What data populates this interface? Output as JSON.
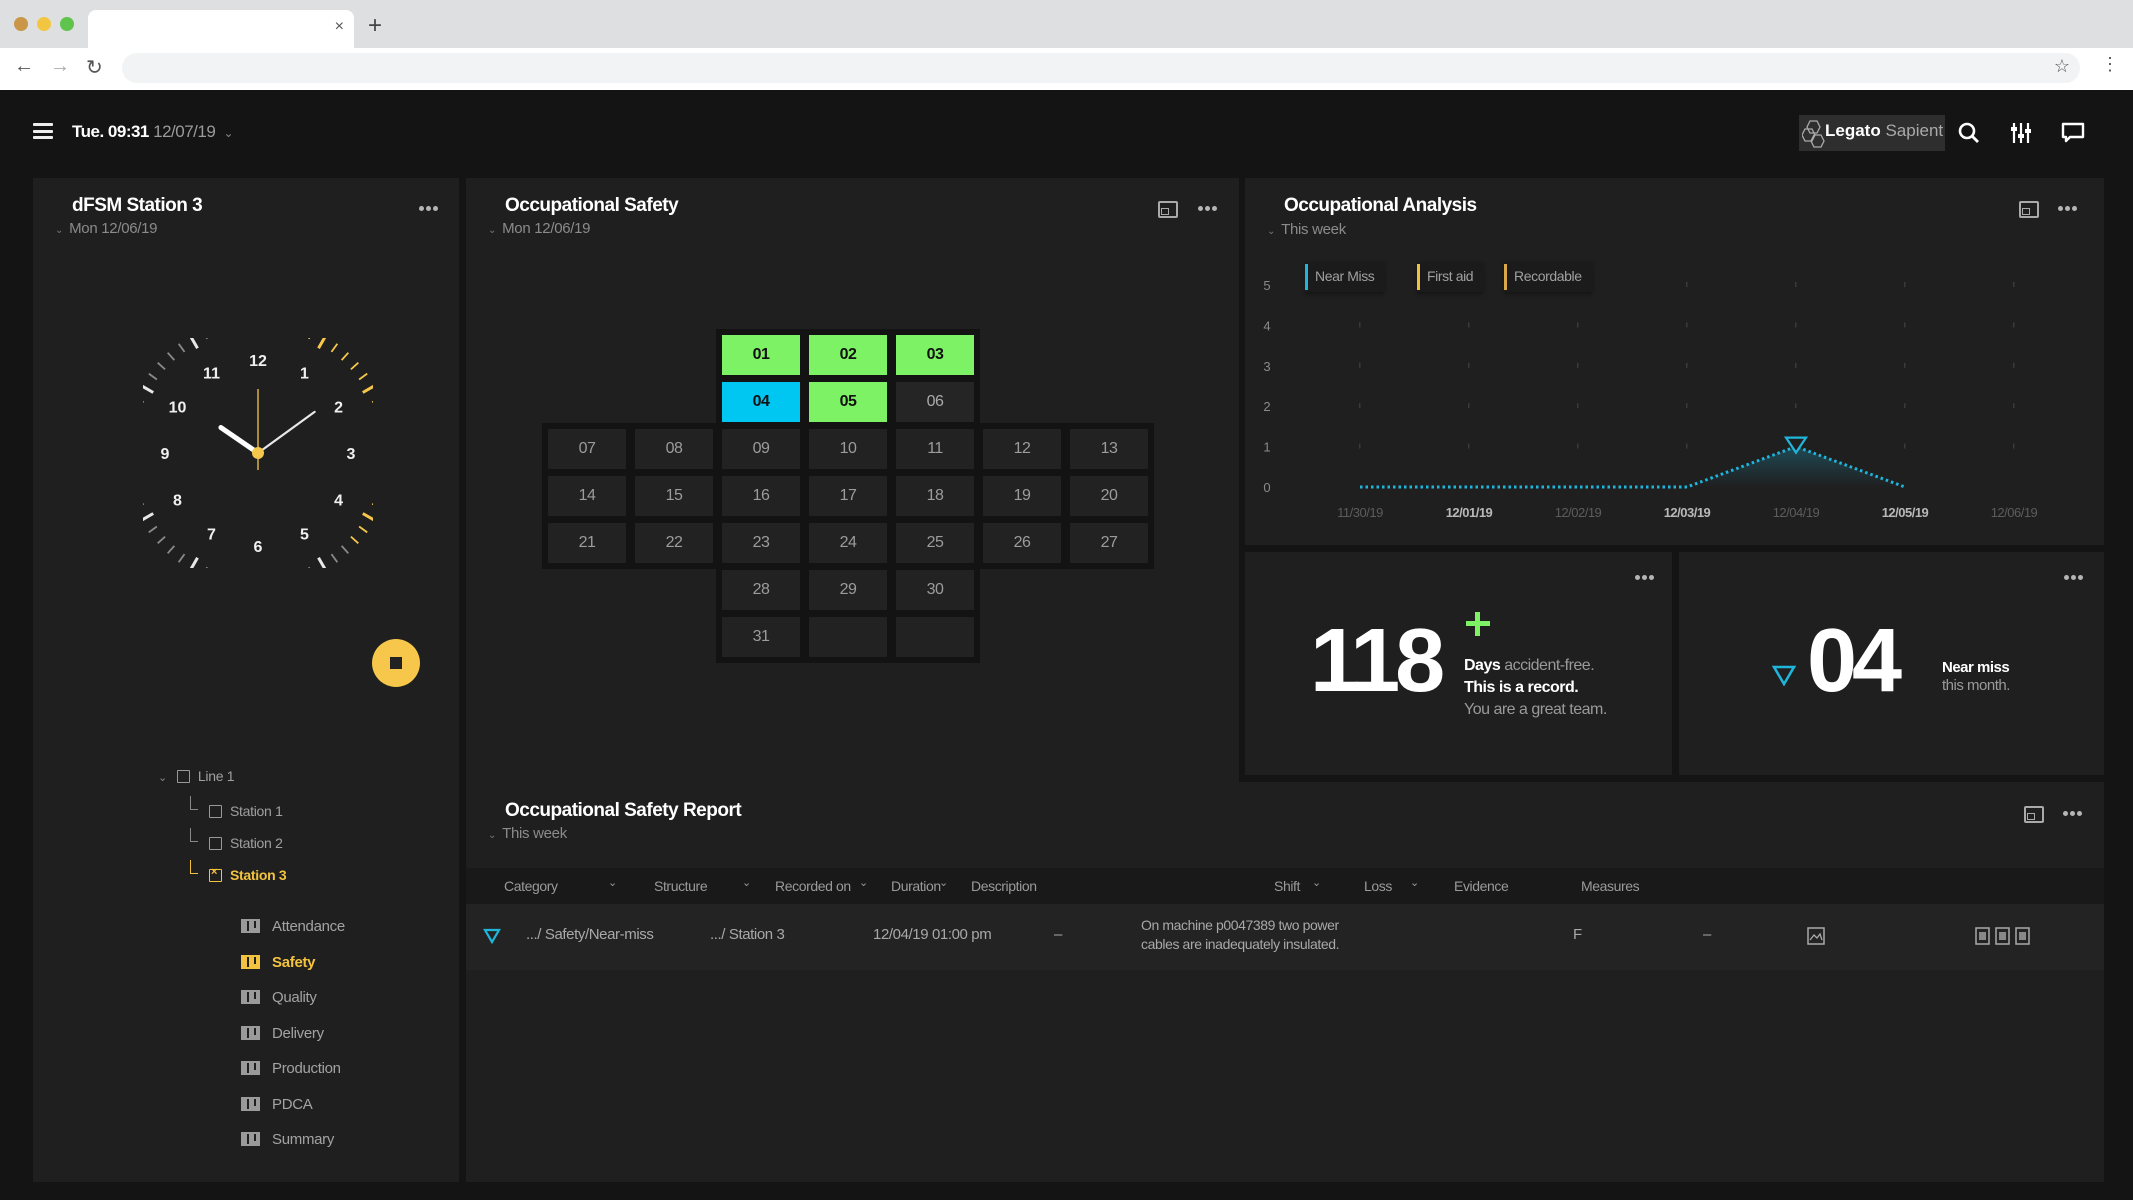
{
  "browser": {
    "tab_close": "×",
    "new_tab": "+",
    "back": "←",
    "forward": "→",
    "reload": "↻",
    "bookmark": "☆",
    "menu": "⋮"
  },
  "header": {
    "day_time": "Tue. 09:31",
    "date": "12/07/19",
    "logo_bold": "Legato",
    "logo_light": "Sapient",
    "icons": [
      "menu-icon",
      "search-icon",
      "sliders-icon",
      "chat-icon"
    ]
  },
  "station_panel": {
    "title": "dFSM Station 3",
    "subtitle": "Mon 12/06/19",
    "clock": {
      "hour_numbers": [
        "12",
        "1",
        "2",
        "3",
        "4",
        "5",
        "6",
        "7",
        "8",
        "9",
        "10",
        "11"
      ],
      "hour": 10,
      "minute": 9,
      "highlight_to_minute": 22,
      "accent_color": "#f6c74a"
    },
    "stop_button": "stop",
    "tree": {
      "root": "Line 1",
      "children": [
        {
          "label": "Station 1",
          "active": false
        },
        {
          "label": "Station 2",
          "active": false
        },
        {
          "label": "Station 3",
          "active": true
        }
      ]
    },
    "nav": [
      {
        "label": "Attendance",
        "active": false
      },
      {
        "label": "Safety",
        "active": true
      },
      {
        "label": "Quality",
        "active": false
      },
      {
        "label": "Delivery",
        "active": false
      },
      {
        "label": "Production",
        "active": false
      },
      {
        "label": "PDCA",
        "active": false
      },
      {
        "label": "Summary",
        "active": false
      }
    ]
  },
  "safety_panel": {
    "title": "Occupational Safety",
    "subtitle": "Mon 12/06/19",
    "days": [
      {
        "d": "01",
        "status": "green"
      },
      {
        "d": "02",
        "status": "green"
      },
      {
        "d": "03",
        "status": "green"
      },
      {
        "d": "04",
        "status": "blue"
      },
      {
        "d": "05",
        "status": "green"
      },
      {
        "d": "06",
        "status": "today"
      },
      {
        "d": "07"
      },
      {
        "d": "08"
      },
      {
        "d": "09"
      },
      {
        "d": "10"
      },
      {
        "d": "11"
      },
      {
        "d": "12"
      },
      {
        "d": "13"
      },
      {
        "d": "14"
      },
      {
        "d": "15"
      },
      {
        "d": "16"
      },
      {
        "d": "17"
      },
      {
        "d": "18"
      },
      {
        "d": "19"
      },
      {
        "d": "20"
      },
      {
        "d": "21"
      },
      {
        "d": "22"
      },
      {
        "d": "23"
      },
      {
        "d": "24"
      },
      {
        "d": "25"
      },
      {
        "d": "26"
      },
      {
        "d": "27"
      },
      {
        "d": "28"
      },
      {
        "d": "29"
      },
      {
        "d": "30"
      },
      {
        "d": "31"
      },
      {
        "d": ""
      },
      {
        "d": ""
      }
    ],
    "colors": {
      "green": "#7ef265",
      "blue": "#00c6f2"
    }
  },
  "analysis_panel": {
    "title": "Occupational Analysis",
    "subtitle": "This week"
  },
  "chart_data": {
    "type": "line",
    "title": "Occupational Analysis",
    "x": [
      "11/30/19",
      "12/01/19",
      "12/02/19",
      "12/03/19",
      "12/04/19",
      "12/05/19",
      "12/06/19"
    ],
    "x_bold": [
      false,
      true,
      false,
      true,
      false,
      true,
      false
    ],
    "yticks": [
      0,
      1,
      2,
      3,
      4,
      5
    ],
    "ylim": [
      0,
      5
    ],
    "grid": true,
    "legend_position": "top-left",
    "series": [
      {
        "name": "Near Miss",
        "color": "#1fb6dc",
        "values": [
          0,
          0,
          0,
          0,
          1,
          0,
          null
        ],
        "marker_at": 4
      },
      {
        "name": "First aid",
        "color": "#f0c040",
        "values": []
      },
      {
        "name": "Recordable",
        "color": "#d9a84a",
        "values": []
      }
    ]
  },
  "stats": {
    "accident_free": {
      "value": "118",
      "line1_bold": "Days",
      "line1_rest": " accident-free.",
      "line2": "This is a record.",
      "line3": "You are a great team.",
      "icon_color": "#7ef265"
    },
    "near_miss": {
      "value": "04",
      "line1": "Near miss",
      "line2": "this month.",
      "icon_color": "#1fb6dc"
    }
  },
  "report_panel": {
    "title": "Occupational Safety Report",
    "subtitle": "This week",
    "columns": [
      {
        "label": "Category",
        "sortable": true
      },
      {
        "label": "Structure",
        "sortable": true
      },
      {
        "label": "Recorded on",
        "sortable": true
      },
      {
        "label": "Duration",
        "sortable": true
      },
      {
        "label": "Description",
        "sortable": false
      },
      {
        "label": "Shift",
        "sortable": true
      },
      {
        "label": "Loss",
        "sortable": true
      },
      {
        "label": "Evidence",
        "sortable": false
      },
      {
        "label": "Measures",
        "sortable": false
      }
    ],
    "rows": [
      {
        "category": ".../ Safety/Near-miss",
        "structure": ".../ Station 3",
        "recorded_on": "12/04/19 01:00 pm",
        "duration": "–",
        "description_line1": "On machine p0047389 two power",
        "description_line2": "cables are inadequately insulated.",
        "shift": "F",
        "loss": "–",
        "evidence": "image-icon",
        "measures": [
          "doc-icon",
          "doc-icon",
          "doc-icon"
        ]
      }
    ]
  }
}
